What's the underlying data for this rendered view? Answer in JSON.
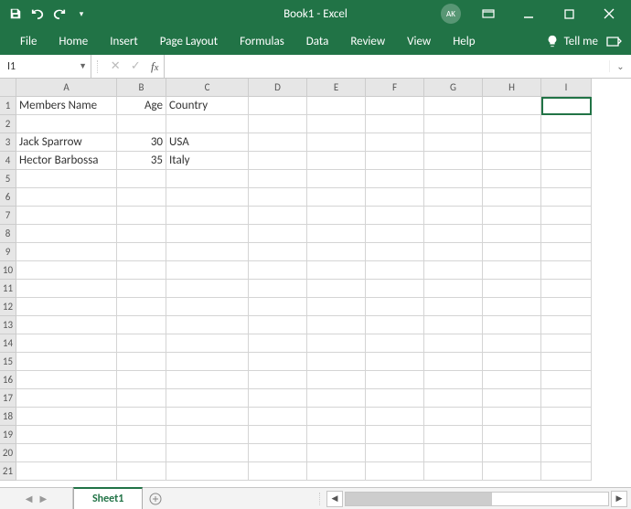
{
  "title": "Book1  -  Excel",
  "user_initials": "AK",
  "ribbon": {
    "tabs": [
      "File",
      "Home",
      "Insert",
      "Page Layout",
      "Formulas",
      "Data",
      "Review",
      "View",
      "Help"
    ],
    "tell_me": "Tell me"
  },
  "name_box": "I1",
  "formula_value": "",
  "columns": [
    {
      "letter": "A",
      "width": 110
    },
    {
      "letter": "B",
      "width": 54
    },
    {
      "letter": "C",
      "width": 90
    },
    {
      "letter": "D",
      "width": 64
    },
    {
      "letter": "E",
      "width": 64
    },
    {
      "letter": "F",
      "width": 64
    },
    {
      "letter": "G",
      "width": 64
    },
    {
      "letter": "H",
      "width": 64
    },
    {
      "letter": "I",
      "width": 55
    }
  ],
  "row_numbers": [
    1,
    2,
    3,
    4,
    5,
    6,
    7,
    8,
    9,
    10,
    11,
    12,
    13,
    14,
    15,
    16,
    17,
    18,
    19,
    20,
    21
  ],
  "cells": {
    "A1": "Members Name",
    "B1": "Age",
    "C1": "Country",
    "A3": "Jack Sparrow",
    "B3": "30",
    "C3": "USA",
    "A4": "Hector Barbossa",
    "B4": "35",
    "C4": "Italy"
  },
  "selected_cell": "I1",
  "sheet_tab": "Sheet1"
}
